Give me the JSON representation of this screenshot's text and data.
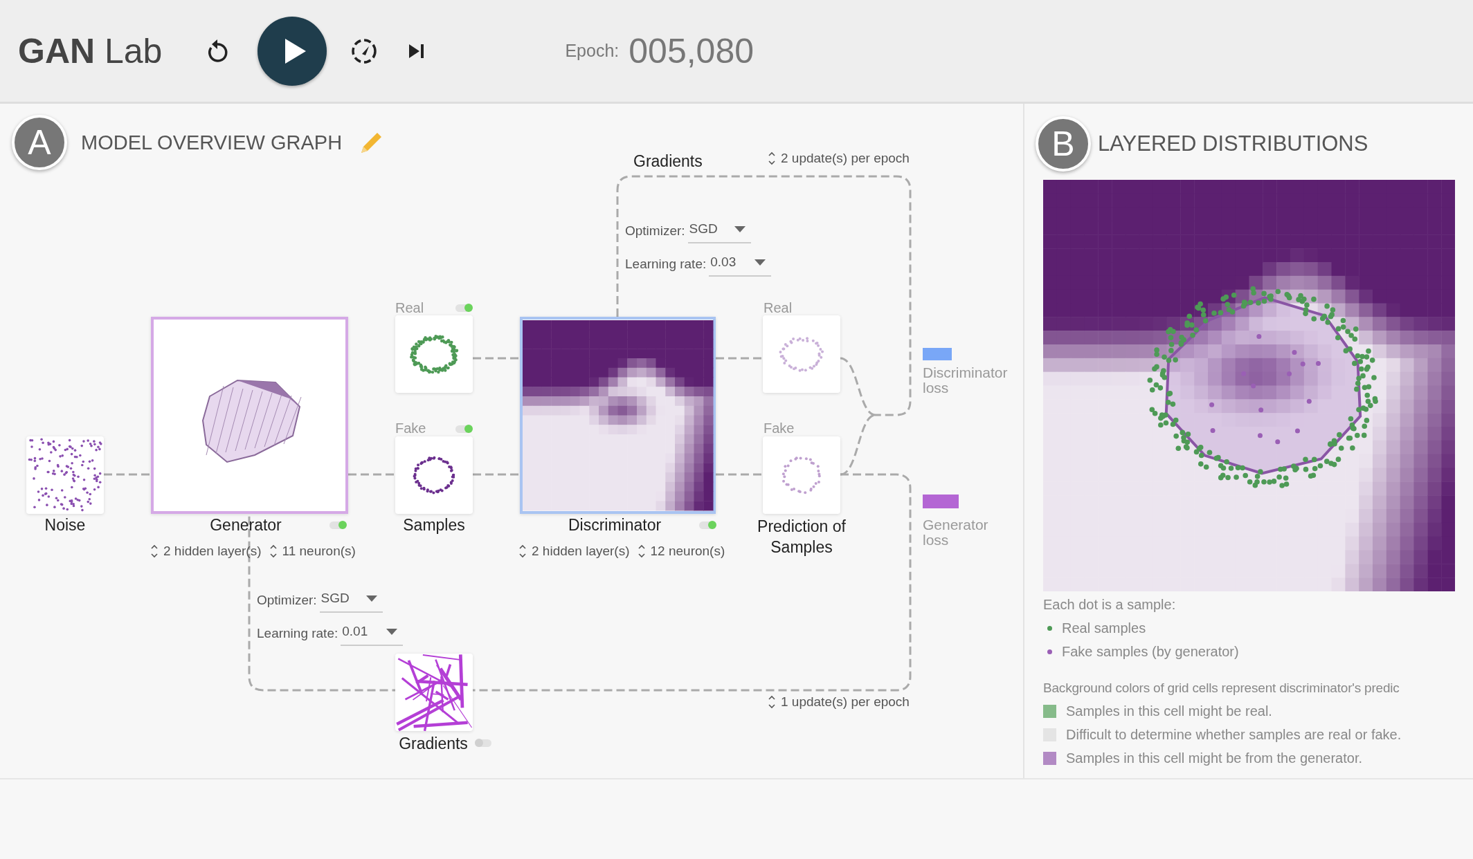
{
  "header": {
    "title": "**GAN** Lab",
    "playing": false,
    "epoch_label": "Epoch:",
    "epoch_value": "005,080"
  },
  "model_graph": {
    "badge": "A",
    "title": "MODEL OVERVIEW GRAPH",
    "noise": {
      "label": "Noise"
    },
    "generator": {
      "label": "Generator",
      "hidden_layers": "2 hidden layer(s)",
      "neurons": "11 neuron(s)",
      "on": true
    },
    "samples": {
      "label": "Samples",
      "real": {
        "caption": "Real",
        "on": true
      },
      "fake": {
        "caption": "Fake",
        "on": true
      }
    },
    "discriminator": {
      "label": "Discriminator",
      "hidden_layers": "2 hidden layer(s)",
      "neurons": "12 neuron(s)",
      "on": true
    },
    "prediction": {
      "label": "Prediction of Samples",
      "real_caption": "Real",
      "fake_caption": "Fake"
    },
    "losses": [
      {
        "label": "Discriminator loss",
        "color": "#79a7f7"
      },
      {
        "label": "Generator loss",
        "color": "#b466d4"
      }
    ],
    "discriminator_training": {
      "title": "Gradients",
      "updates": "2 update(s) per epoch",
      "optimizer_label": "Optimizer:",
      "optimizer": "SGD",
      "learning_rate_label": "Learning rate:",
      "learning_rate": "0.03"
    },
    "generator_training": {
      "optimizer_label": "Optimizer:",
      "optimizer": "SGD",
      "learning_rate_label": "Learning rate:",
      "learning_rate": "0.01",
      "gradients_label": "Gradients",
      "gradients_on": false,
      "updates": "1 update(s) per epoch"
    }
  },
  "distributions": {
    "badge": "B",
    "title": "LAYERED DISTRIBUTIONS",
    "dots_heading": "Each dot is a sample:",
    "dot_legend": [
      {
        "label": "Real samples",
        "color": "#4e9a56"
      },
      {
        "label": "Fake samples (by generator)",
        "color": "#9a5fb5"
      }
    ],
    "cells_heading": "Background colors of grid cells represent discriminator's predic",
    "cell_legend": [
      {
        "label": "Samples in this cell might be real.",
        "color": "#86bb8a"
      },
      {
        "label": "Difficult to determine whether samples are real or fake.",
        "color": "#e4e4e4"
      },
      {
        "label": "Samples in this cell might be from the generator.",
        "color": "#b28ac4"
      }
    ]
  }
}
